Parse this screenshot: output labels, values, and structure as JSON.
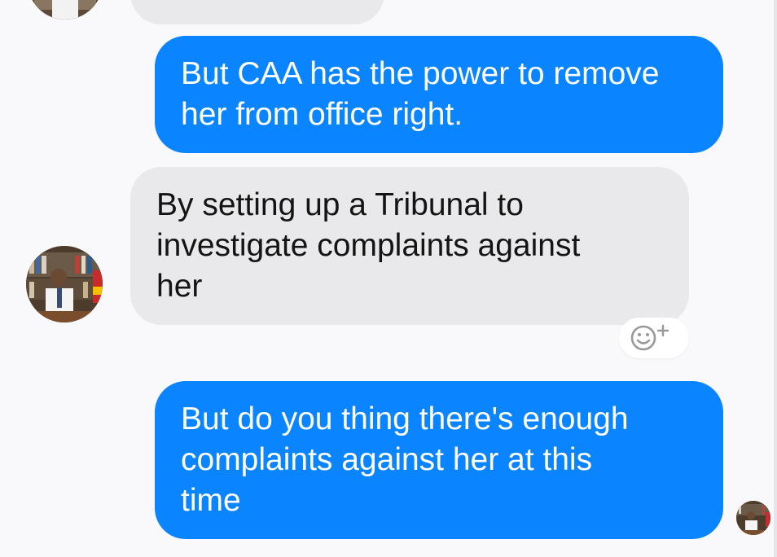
{
  "conversation": {
    "messages": [
      {
        "sender": "me",
        "text": "But CAA has the power to remove\nher from office right."
      },
      {
        "sender": "contact",
        "text": "By setting up a Tribunal to\ninvestigate complaints against\nher"
      },
      {
        "sender": "me",
        "text": "But do you thing there's enough\ncomplaints against her at this\ntime"
      }
    ]
  },
  "icons": {
    "add_reaction": "smiley-plus-icon",
    "contact_avatar": "contact-avatar",
    "my_avatar": "my-avatar"
  },
  "colors": {
    "outgoing_bubble": "#0a84ff",
    "incoming_bubble": "#e9e9eb",
    "background": "#f9f9fb"
  }
}
